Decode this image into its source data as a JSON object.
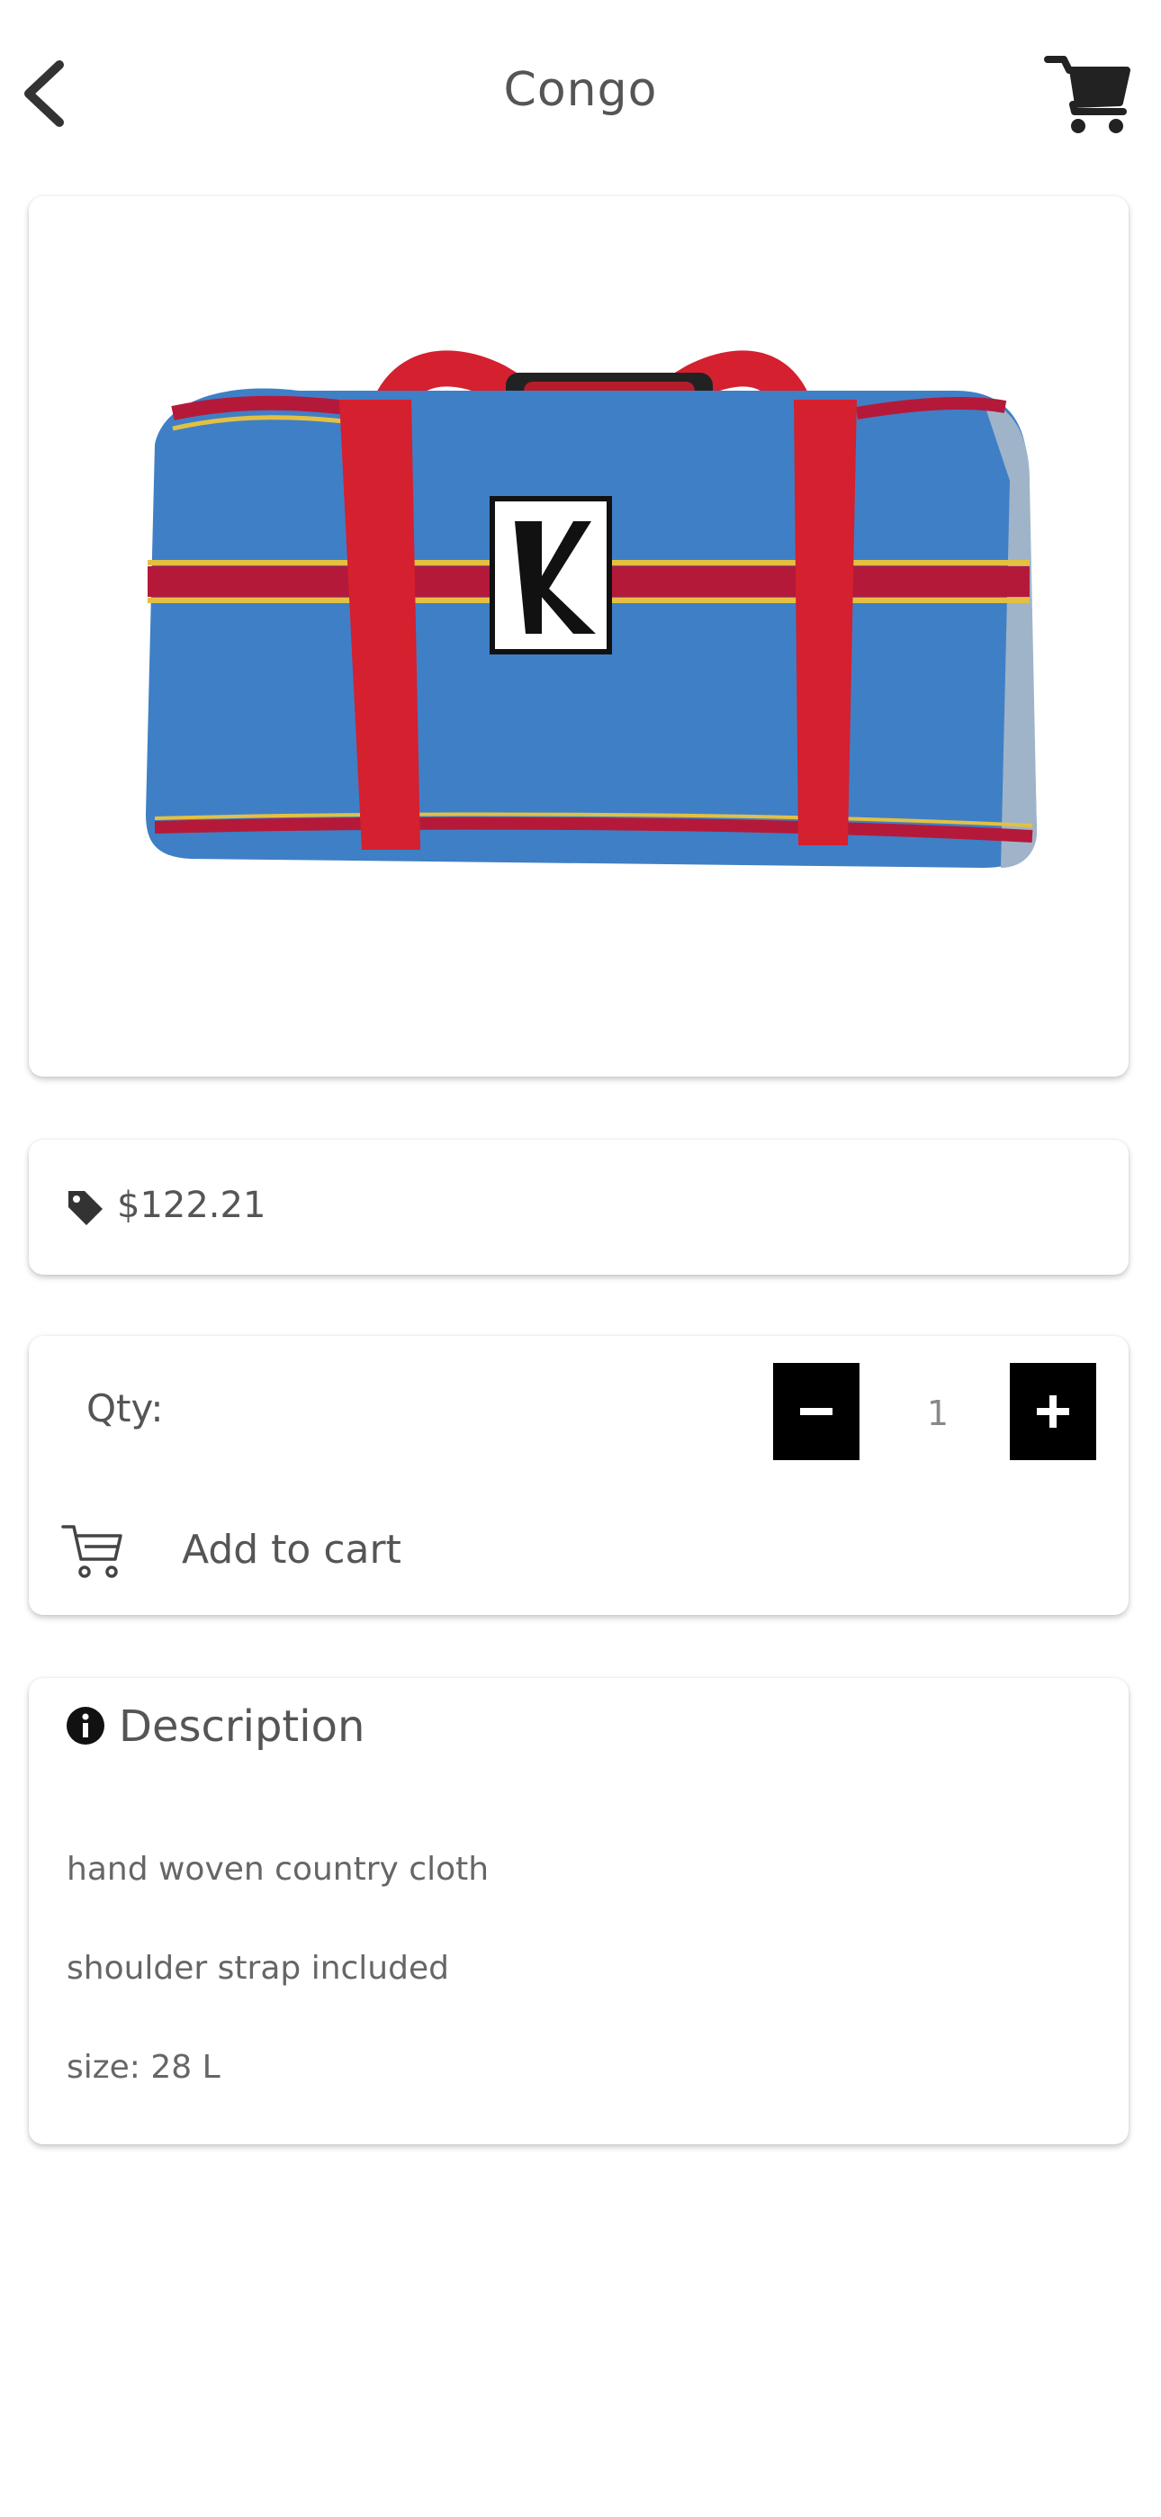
{
  "header": {
    "title": "Congo",
    "back_icon": "chevron-left-icon",
    "cart_icon": "shopping-cart-icon"
  },
  "product": {
    "image_alt": "blue duffel bag with red handles",
    "price": "$122.21",
    "price_icon": "tag-icon"
  },
  "quantity": {
    "label": "Qty:",
    "value": "1",
    "minus_icon": "minus-icon",
    "plus_icon": "plus-icon"
  },
  "cart": {
    "add_label": "Add to cart",
    "add_icon": "cart-outline-icon"
  },
  "description": {
    "heading": "Description",
    "heading_icon": "info-circle-icon",
    "lines": [
      "hand woven country cloth",
      "shoulder strap included",
      "size: 28 L"
    ]
  },
  "colors": {
    "button_fill": "#000000",
    "bag_blue": "#3f7fc6",
    "bag_red": "#d4202f"
  }
}
